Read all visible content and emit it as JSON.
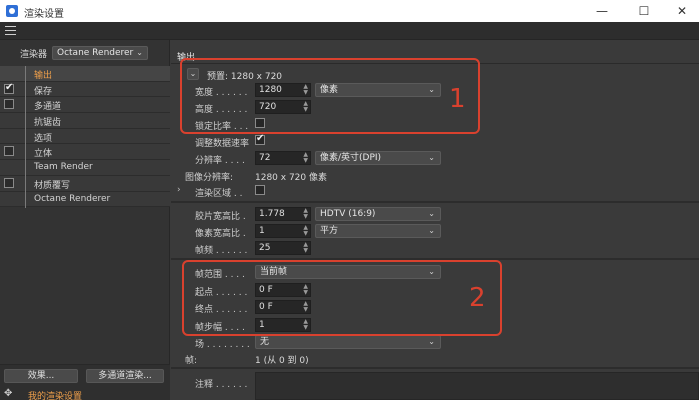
{
  "window": {
    "title": "渲染设置",
    "minimize": "—",
    "maximize": "☐",
    "close": "✕"
  },
  "sidebar": {
    "renderer_label": "渲染器",
    "renderer_value": "Octane Renderer",
    "items": [
      {
        "label": "输出",
        "checkbox": false,
        "checked": false,
        "active": true
      },
      {
        "label": "保存",
        "checkbox": true,
        "checked": true,
        "active": false
      },
      {
        "label": "多通道",
        "checkbox": true,
        "checked": false,
        "active": false
      },
      {
        "label": "抗锯齿",
        "checkbox": false,
        "checked": false,
        "active": false
      },
      {
        "label": "选项",
        "checkbox": false,
        "checked": false,
        "active": false
      },
      {
        "label": "立体",
        "checkbox": true,
        "checked": false,
        "active": false
      },
      {
        "label": "Team Render",
        "checkbox": false,
        "checked": false,
        "active": false
      },
      {
        "label": "材质覆写",
        "checkbox": true,
        "checked": false,
        "active": false
      },
      {
        "label": "Octane Renderer",
        "checkbox": false,
        "checked": false,
        "active": false
      }
    ],
    "effects_button": "效果...",
    "multipass_button": "多通道渲染...",
    "my_settings": "我的渲染设置"
  },
  "output": {
    "header": "输出",
    "preset": "预置: 1280 x 720",
    "width_label": "宽度 . . . . . .",
    "width_value": "1280",
    "unit_value": "像素",
    "height_label": "高度 . . . . . .",
    "height_value": "720",
    "lock_ratio_label": "锁定比率 . . .",
    "adjust_rate_label": "调整数据速率",
    "resolution_label": "分辨率 . . . .",
    "resolution_value": "72",
    "resolution_unit": "像素/英寸(DPI)",
    "image_res_label": "图像分辨率:",
    "image_res_value": "1280 x 720 像素",
    "render_region_label": "渲染区域 . .",
    "film_aspect_label": "胶片宽高比 .",
    "film_aspect_value": "1.778",
    "film_aspect_preset": "HDTV (16:9)",
    "pixel_aspect_label": "像素宽高比 .",
    "pixel_aspect_value": "1",
    "pixel_aspect_preset": "平方",
    "framerate_label": "帧频 . . . . . .",
    "framerate_value": "25",
    "frame_range_label": "帧范围 . . . .",
    "frame_range_value": "当前帧",
    "start_label": "起点 . . . . . .",
    "start_value": "0 F",
    "end_label": "终点 . . . . . .",
    "end_value": "0 F",
    "step_label": "帧步幅 . . . .",
    "step_value": "1",
    "field_label": "场 . . . . . . . .",
    "field_value": "无",
    "frames_label": "帧:",
    "frames_value": "1 (从 0 到 0)",
    "notes_label": "注释 . . . . . ."
  },
  "annotations": {
    "box1_number": "1",
    "box2_number": "2",
    "color": "#d9412e"
  }
}
